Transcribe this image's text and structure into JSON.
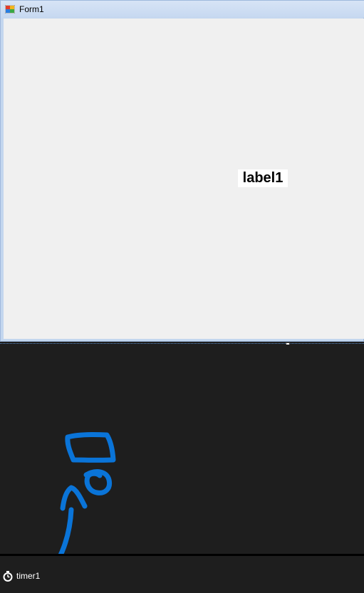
{
  "form": {
    "title": "Form1",
    "icon": "form-icon",
    "label": "label1"
  },
  "tray": {
    "items": [
      {
        "label": "timer1",
        "icon": "timer-icon"
      }
    ]
  },
  "colors": {
    "annotation": "#0a74d8",
    "surface": "#1e1e1e",
    "form_client": "#f0f0f0",
    "titlebar": "#c6d8f0"
  }
}
